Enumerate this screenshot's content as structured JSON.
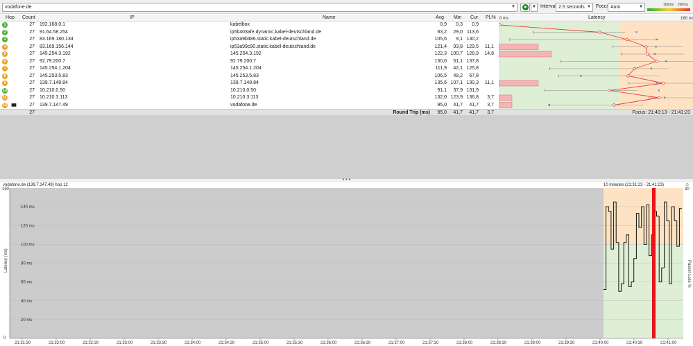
{
  "toolbar": {
    "target": "vodafone.de",
    "interval_label": "Interval",
    "interval_value": "2.5 seconds",
    "focus_label": "Focus",
    "focus_value": "Auto",
    "legend_100": "100ms",
    "legend_200": "200ms"
  },
  "columns": {
    "hop": "Hop",
    "count": "Count",
    "ip": "IP",
    "name": "Name",
    "avg": "Avg",
    "min": "Min",
    "cur": "Cur",
    "pl": "PL%",
    "latency": "Latency",
    "lat_min": "0 ms",
    "lat_max": "160 ms"
  },
  "hops": [
    {
      "hop": "1",
      "count": "27",
      "ip": "192.168.0.1",
      "name": "kabelbox",
      "avg": "0,9",
      "min": "0,3",
      "cur": "0,9",
      "pl": "",
      "color": "#4caf3a"
    },
    {
      "hop": "2",
      "count": "27",
      "ip": "91.64.58.254",
      "name": "ip5b403afe.dynamic.kabel-deutschland.de",
      "avg": "83,2",
      "min": "29,0",
      "cur": "113,6",
      "pl": "",
      "color": "#4caf3a"
    },
    {
      "hop": "3",
      "count": "27",
      "ip": "83.169.180.134",
      "name": "ip53a9b486.static.kabel-deutschland.de",
      "avg": "105,6",
      "min": "9,1",
      "cur": "130,2",
      "pl": "",
      "color": "#4caf3a"
    },
    {
      "hop": "4",
      "count": "27",
      "ip": "83.169.156.144",
      "name": "ip53a99c90.static.kabel-deutschland.de",
      "avg": "121,4",
      "min": "93,8",
      "cur": "129,5",
      "pl": "11,1",
      "color": "#f0a020"
    },
    {
      "hop": "5",
      "count": "27",
      "ip": "145.254.3.192",
      "name": "145.254.3.192",
      "avg": "122,3",
      "min": "100,7",
      "cur": "128,9",
      "pl": "14,8",
      "color": "#f0a020"
    },
    {
      "hop": "6",
      "count": "27",
      "ip": "92.79.200.7",
      "name": "92.79.200.7",
      "avg": "130,0",
      "min": "51,1",
      "cur": "137,8",
      "pl": "",
      "color": "#f0a020"
    },
    {
      "hop": "7",
      "count": "27",
      "ip": "145.254.1.204",
      "name": "145.254.1.204",
      "avg": "111,9",
      "min": "42,1",
      "cur": "125,8",
      "pl": "",
      "color": "#f0a020"
    },
    {
      "hop": "8",
      "count": "27",
      "ip": "145.253.5.83",
      "name": "145.253.5.83",
      "avg": "106,5",
      "min": "49,2",
      "cur": "67,8",
      "pl": "",
      "color": "#f0a020"
    },
    {
      "hop": "9",
      "count": "27",
      "ip": "139.7.148.84",
      "name": "139.7.148.84",
      "avg": "135,6",
      "min": "107,1",
      "cur": "130,3",
      "pl": "11,1",
      "color": "#f0a020"
    },
    {
      "hop": "10",
      "count": "27",
      "ip": "10.210.0.50",
      "name": "10.210.0.50",
      "avg": "91,1",
      "min": "37,9",
      "cur": "131,9",
      "pl": "",
      "color": "#4caf3a"
    },
    {
      "hop": "11",
      "count": "27",
      "ip": "10.210.3.113",
      "name": "10.210.3.113",
      "avg": "132,0",
      "min": "123,9",
      "cur": "136,8",
      "pl": "3,7",
      "color": "#f0a020"
    },
    {
      "hop": "12",
      "count": "27",
      "ip": "139.7.147.49",
      "name": "vodafone.de",
      "avg": "95,0",
      "min": "41,7",
      "cur": "41,7",
      "pl": "3,7",
      "color": "#f0a020"
    }
  ],
  "summary": {
    "count": "27",
    "label": "Round Trip (ms)",
    "avg": "95,0",
    "min": "41,7",
    "cur": "41,7",
    "pl": "3,7",
    "focus": "Focus: 21:40:13 - 21:41:23"
  },
  "timeline": {
    "title": "vodafone.de (139.7.147.49) hop 12",
    "range": "10 minutes (21:31:23 - 21:41:23)",
    "y_label": "Latency (ms)",
    "y2_label": "Packet Loss %",
    "y_top": "160",
    "y_bottom": "0",
    "y2_top": "30",
    "y_ticks": [
      "140 ms",
      "120 ms",
      "100 ms",
      "80 ms",
      "60 ms",
      "40 ms",
      "20 ms"
    ],
    "x_ticks": [
      "21:31:30",
      "21:32:00",
      "21:32:30",
      "21:33:00",
      "21:33:30",
      "21:34:00",
      "21:34:30",
      "21:35:00",
      "21:35:30",
      "21:36:00",
      "21:36:30",
      "21:37:00",
      "21:37:30",
      "21:38:00",
      "21:38:30",
      "21:39:00",
      "21:39:30",
      "21:40:00",
      "21:40:30",
      "21:41:00"
    ]
  },
  "chart_data": {
    "type": "line",
    "title": "vodafone.de (139.7.147.49) hop 12",
    "ylabel": "Latency (ms)",
    "ylim": [
      0,
      160
    ],
    "y2lim": [
      0,
      30
    ],
    "series": [
      {
        "name": "latency",
        "values": [
          52,
          140,
          135,
          95,
          145,
          102,
          50,
          58,
          102,
          110,
          55,
          60,
          85,
          133,
          118,
          140,
          100,
          142,
          88,
          110,
          135,
          130,
          60,
          75,
          145,
          125,
          58,
          140,
          125,
          98,
          138
        ]
      }
    ],
    "packet_loss_time": "21:40:53"
  },
  "colors": {
    "green_zone": "#deefd6",
    "orange_zone": "#fde3c4",
    "red": "#e8141a",
    "grey": "#cccccc"
  }
}
